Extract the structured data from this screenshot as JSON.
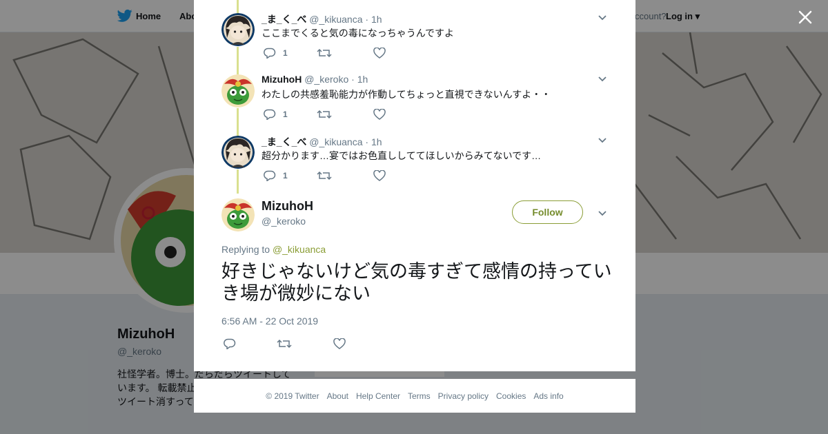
{
  "topbar": {
    "home_label": "Home",
    "about_label": "Abo",
    "account_prompt": "ccount?",
    "login_label": "Log in"
  },
  "profile": {
    "name": "MizuhoH",
    "handle": "@_keroko",
    "bio": "社怪学者。博士。だらだらツイートしています。 転載禁止。 たち」(青弓社)ア らツイート消すっては。"
  },
  "bg_ads_info": "Ads info",
  "thread": [
    {
      "name": "_ま_く_べ",
      "handle": "@_kikuanca",
      "time": "· 1h",
      "text": "ここまでくると気の毒になっちゃうんですよ",
      "reply_count": "1",
      "avatar": "dark-hair-character"
    },
    {
      "name": "MizuhoH",
      "handle": "@_keroko",
      "time": "· 1h",
      "text": "わたしの共感羞恥能力が作動してちょっと直視できないんすよ・・",
      "reply_count": "1",
      "avatar": "green-frog-character"
    },
    {
      "name": "_ま_く_べ",
      "handle": "@_kikuanca",
      "time": "· 1h",
      "text": "超分かります…宴ではお色直ししててほしいからみてないです…",
      "reply_count": "1",
      "avatar": "dark-hair-character"
    }
  ],
  "main_tweet": {
    "name": "MizuhoH",
    "handle": "@_keroko",
    "follow_label": "Follow",
    "replying_prefix": "Replying to",
    "replying_to": "@_kikuanca",
    "text": "好きじゃないけど気の毒すぎて感情の持っていき場が微妙にない",
    "timestamp": "6:56 AM - 22 Oct 2019"
  },
  "footer": {
    "copyright": "© 2019 Twitter",
    "links": [
      "About",
      "Help Center",
      "Terms",
      "Privacy policy",
      "Cookies",
      "Ads info"
    ]
  },
  "colors": {
    "accent": "#8a9d35",
    "thread_line": "#d9e08f",
    "muted": "#657786",
    "twitter_blue": "#1da1f2"
  }
}
